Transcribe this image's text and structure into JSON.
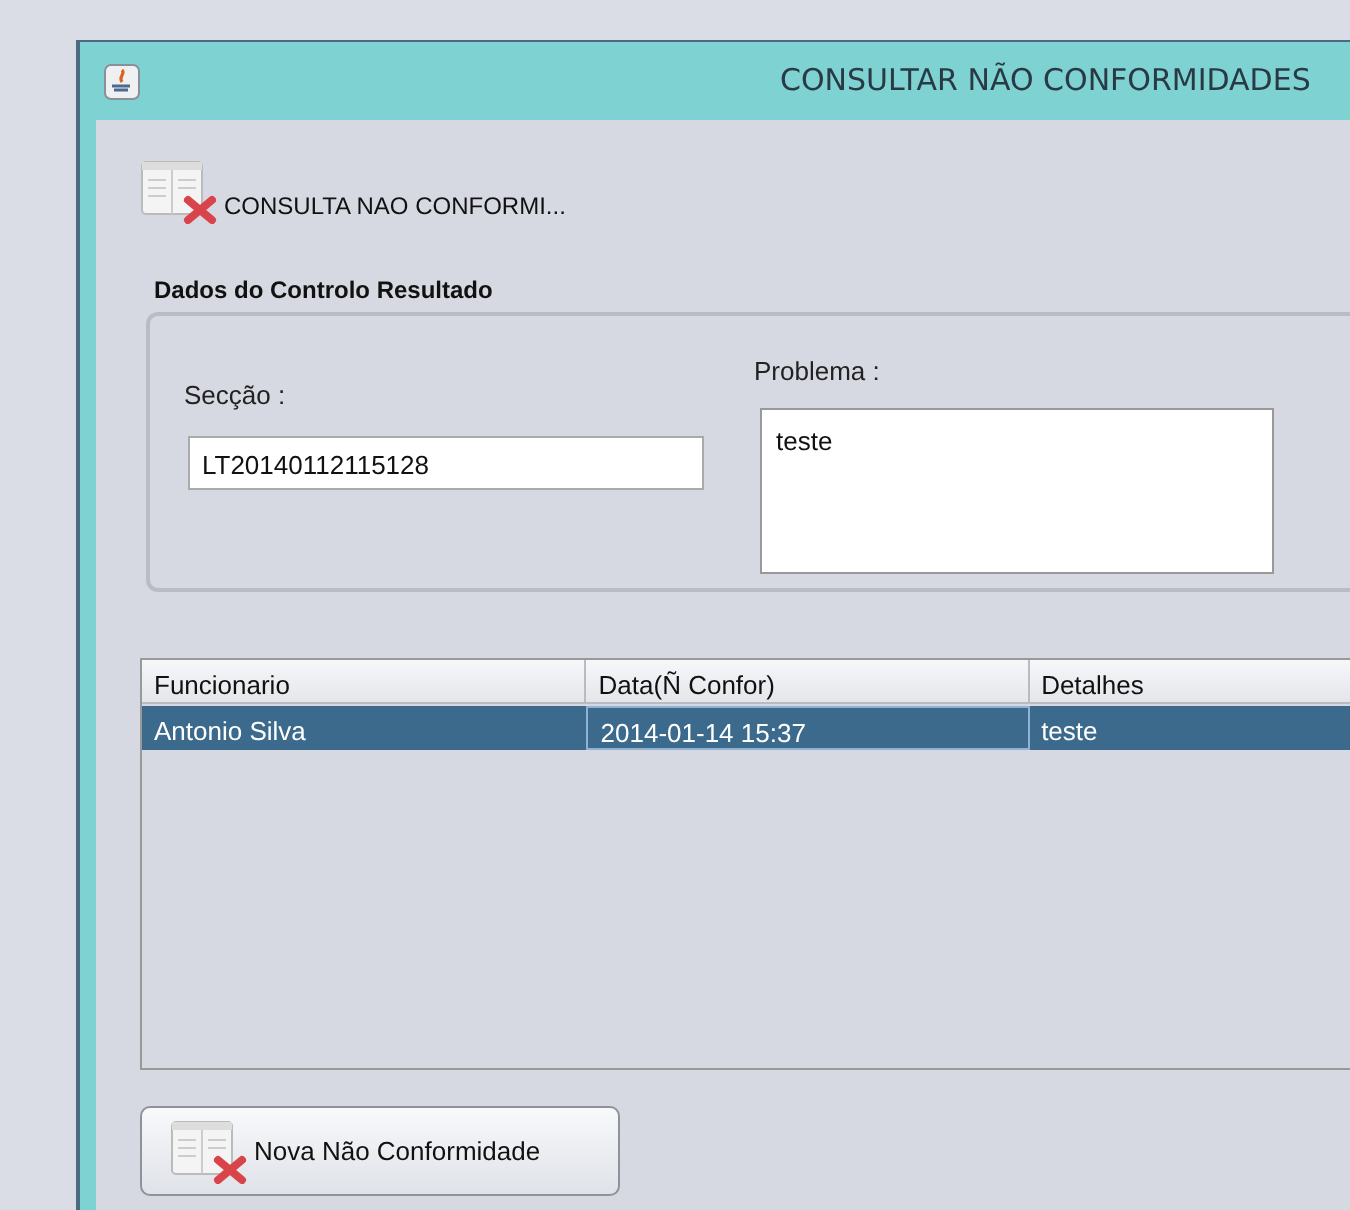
{
  "window": {
    "title": "CONSULTAR NÃO CONFORMIDADES"
  },
  "header": {
    "label": "CONSULTA NAO CONFORMI..."
  },
  "group": {
    "title": "Dados do Controlo Resultado",
    "seccao": {
      "label": "Secção :",
      "value": "LT20140112115128"
    },
    "problema": {
      "label": "Problema :",
      "value": "teste"
    }
  },
  "table": {
    "columns": [
      "Funcionario",
      "Data(Ñ Confor)",
      "Detalhes"
    ],
    "rows": [
      {
        "cells": [
          "Antonio Silva",
          "2014-01-14 15:37",
          "teste"
        ],
        "selected": true
      }
    ]
  },
  "buttons": [
    "Nova Não Conformidade"
  ]
}
